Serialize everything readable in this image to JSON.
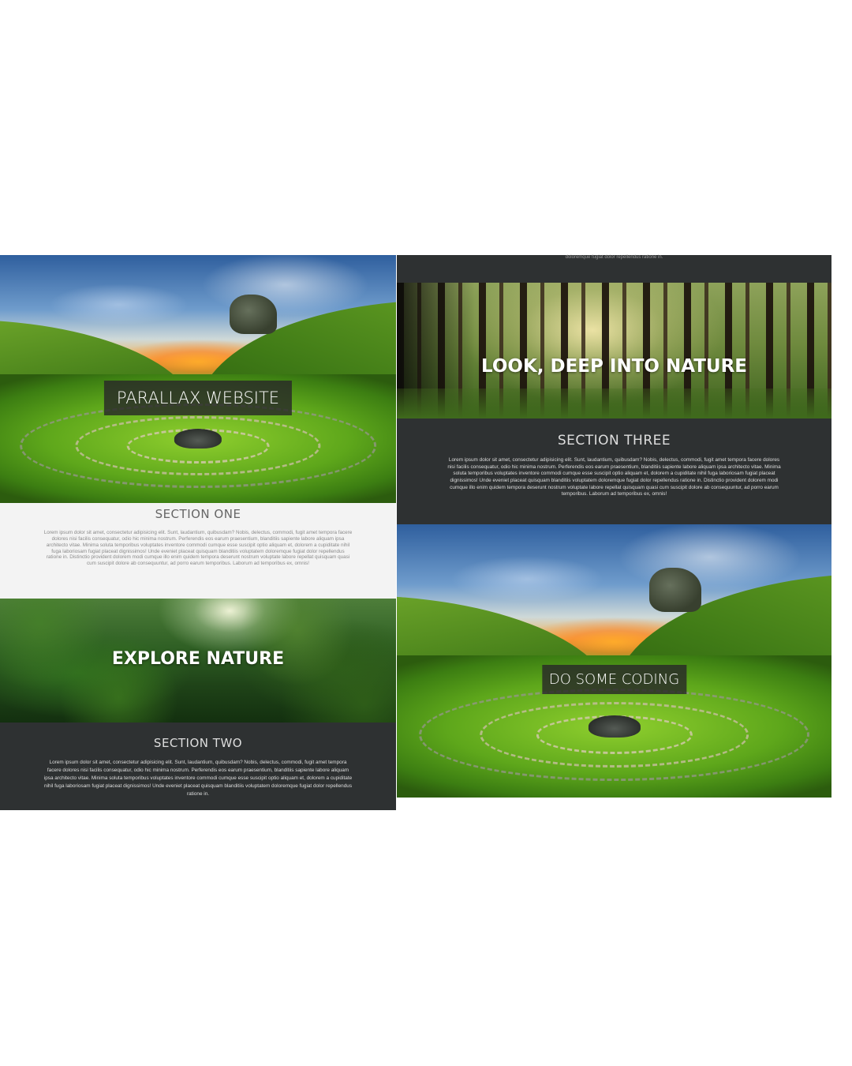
{
  "left_column": {
    "hero_title": "PARALLAX WEBSITE",
    "section_one": {
      "heading": "SECTION ONE",
      "body": "Lorem ipsum dolor sit amet, consectetur adipisicing elit. Sunt, laudantium, quibusdam? Nobis, delectus, commodi, fugit amet tempora facere dolores nisi facilis consequatur, odio hic minima nostrum. Perferendis eos earum praesentium, blanditiis sapiente labore aliquam ipsa architecto vitae. Minima soluta temporibus voluptates inventore commodi cumque esse suscipit optio aliquam et, dolorem a cupiditate nihil fuga laboriosam fugiat placeat dignissimos! Unde eveniet placeat quisquam blanditiis voluptatem doloremque fugiat dolor repellendus ratione in. Distinctio provident dolorem modi cumque illo enim quidem tempora deserunt nostrum voluptate labore repellat quisquam quasi cum suscipit dolore ab consequuntur, ad porro earum temporibus. Laborum ad temporibus ex, omnis!"
    },
    "banner_title": "EXPLORE NATURE",
    "section_two": {
      "heading": "SECTION TWO",
      "body": "Lorem ipsum dolor sit amet, consectetur adipisicing elit. Sunt, laudantium, quibusdam? Nobis, delectus, commodi, fugit amet tempora facere dolores nisi facilis consequatur, odio hic minima nostrum. Perferendis eos earum praesentium, blanditiis sapiente labore aliquam ipsa architecto vitae. Minima soluta temporibus voluptates inventore commodi cumque esse suscipit optio aliquam et, dolorem a cupiditate nihil fuga laboriosam fugiat placeat dignissimos! Unde eveniet placeat quisquam blanditiis voluptatem doloremque fugiat dolor repellendus ratione in."
    }
  },
  "right_column": {
    "top_fragment": "doloremque fugiat dolor repellendus ratione in.",
    "banner_title": "LOOK, DEEP INTO NATURE",
    "section_three": {
      "heading": "SECTION THREE",
      "body": "Lorem ipsum dolor sit amet, consectetur adipisicing elit. Sunt, laudantium, quibusdam? Nobis, delectus, commodi, fugit amet tempora facere dolores nisi facilis consequatur, odio hic minima nostrum. Perferendis eos earum praesentium, blanditiis sapiente labore aliquam ipsa architecto vitae. Minima soluta temporibus voluptates inventore commodi cumque esse suscipit optio aliquam et, dolorem a cupiditate nihil fuga laboriosam fugiat placeat dignissimos! Unde eveniet placeat quisquam blanditiis voluptatem doloremque fugiat dolor repellendus ratione in. Distinctio provident dolorem modi cumque illo enim quidem tempora deserunt nostrum voluptate labore repellat quisquam quasi cum suscipit dolore ab consequuntur, ad porro earum temporibus. Laborum ad temporibus ex, omnis!"
    },
    "hero_title": "DO SOME CODING"
  },
  "colors": {
    "dark_section": "#2e3132",
    "light_section": "#f3f3f3",
    "title_box": "#282828"
  }
}
